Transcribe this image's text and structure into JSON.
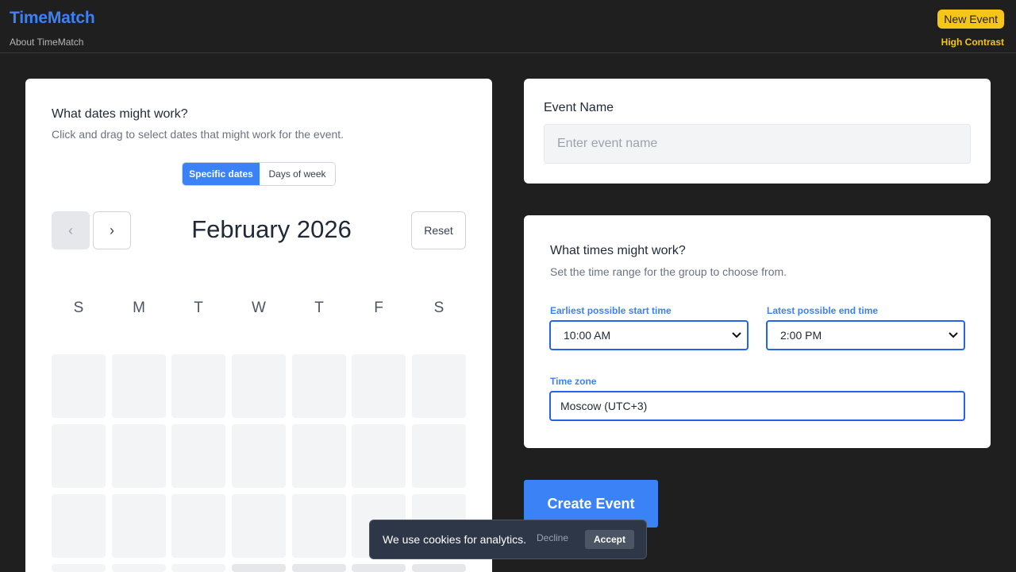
{
  "header": {
    "brand": "TimeMatch",
    "about_link": "About TimeMatch",
    "new_event_button": "New Event",
    "high_contrast_link": "High Contrast"
  },
  "dates": {
    "title": "What dates might work?",
    "subtitle": "Click and drag to select dates that might work for the event.",
    "toggle": {
      "specific_dates": "Specific dates",
      "days_of_week": "Days of week",
      "selected": "Specific dates"
    },
    "prev_icon": "‹",
    "next_icon": "›",
    "month_label": "February 2026",
    "reset_button": "Reset",
    "weekdays": [
      "S",
      "M",
      "T",
      "W",
      "T",
      "F",
      "S"
    ]
  },
  "event_name": {
    "label": "Event Name",
    "placeholder": "Enter event name",
    "value": ""
  },
  "times": {
    "title": "What times might work?",
    "subtitle": "Set the time range for the group to choose from.",
    "start_label": "Earliest possible start time",
    "start_value": "10:00 AM",
    "end_label": "Latest possible end time",
    "end_value": "2:00 PM",
    "timezone_label": "Time zone",
    "timezone_value": "Moscow (UTC+3)"
  },
  "create_button": "Create Event",
  "cookie": {
    "message": "We use cookies for analytics.",
    "decline": "Decline",
    "accept": "Accept"
  },
  "colors": {
    "accent": "#3b82f6",
    "header_yellow": "#f5c518",
    "background": "#1f1f1f"
  },
  "icons": {
    "prev": "chevron-left-icon",
    "next": "chevron-right-icon",
    "select": "chevron-down-icon"
  }
}
